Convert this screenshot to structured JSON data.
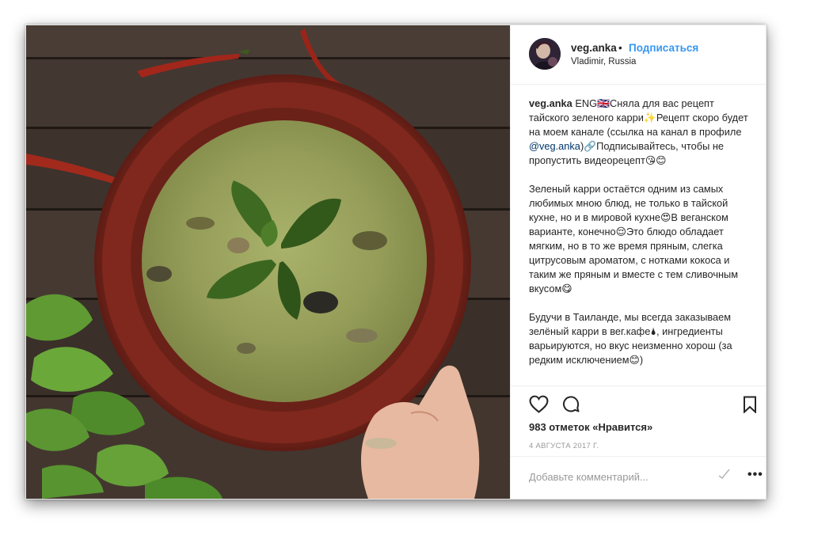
{
  "post": {
    "username": "veg.anka",
    "separator": "•",
    "follow_label": "Подписаться",
    "location": "Vladimir, Russia"
  },
  "caption": {
    "author": "veg.anka",
    "part1_before_mention": " ENG🇬🇧Сняла для вас рецепт тайского зеленого карри✨Рецепт скоро будет на моем канале (ссылка на канал в профиле ",
    "mention": "@veg.anka",
    "part1_after_mention": ")🔗Подписывайтесь, чтобы не пропустить видеорецепт😘😊",
    "paragraph2": "Зеленый карри остаётся одним из самых любимых мною блюд, не только в тайской кухне, но и в мировой кухне😍В веганском варианте, конечно😌Это блюдо обладает мягким, но в то же время пряным, слегка цитрусовым ароматом, с нотками кокоса и таким же пряным и вместе с тем сливочным вкусом😋",
    "paragraph3": "Будучи в Таиланде, мы всегда заказываем зелёный карри в вег.кафе🌢, ингредиенты варьируются, но вкус неизменно хорош (за редким исключением😊)"
  },
  "actions": {
    "like_icon": "heart-outline-icon",
    "comment_icon": "comment-bubble-icon",
    "save_icon": "bookmark-icon"
  },
  "likes_text": "983 отметок «Нравится»",
  "date_text": "4 АВГУСТА 2017 Г.",
  "comment": {
    "placeholder": "Добавьте комментарий...",
    "more_label": "•••"
  },
  "colors": {
    "link_blue": "#3897f0",
    "mention": "#003569",
    "text": "#262626",
    "muted": "#999999"
  }
}
